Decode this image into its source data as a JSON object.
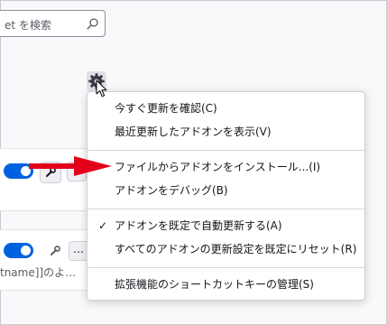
{
  "search": {
    "text": "et を検索"
  },
  "cards": [
    {
      "desc": ""
    },
    {
      "more_label": "…",
      "desc": "tname]]のよ…"
    }
  ],
  "menu": {
    "items": [
      {
        "label": "今すぐ更新を確認(C)"
      },
      {
        "label": "最近更新したアドオンを表示(V)"
      },
      {
        "label": "ファイルからアドオンをインストール...(I)"
      },
      {
        "label": "アドオンをデバッグ(B)"
      },
      {
        "label": "アドオンを既定で自動更新する(A)",
        "check": "✓"
      },
      {
        "label": "すべてのアドオンの更新設定を既定にリセット(R)"
      },
      {
        "label": "拡張機能のショートカットキーの管理(S)"
      }
    ]
  },
  "colors": {
    "accent": "#0061e0",
    "arrow": "#e2001a"
  }
}
